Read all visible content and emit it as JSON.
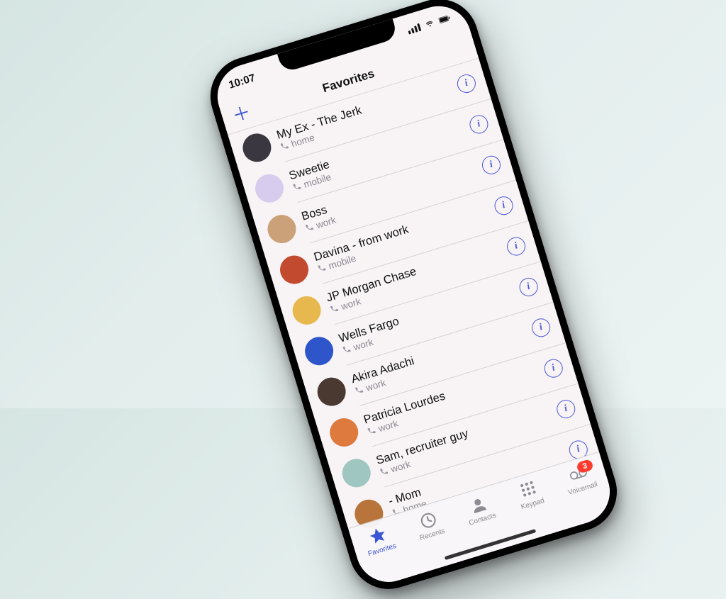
{
  "status": {
    "time": "10:07"
  },
  "navbar": {
    "title": "Favorites"
  },
  "favorites": [
    {
      "name": "My Ex - The Jerk",
      "label": "home",
      "avatar_class": "av-dark"
    },
    {
      "name": "Sweetie",
      "label": "mobile",
      "avatar_class": "av-lilac"
    },
    {
      "name": "Boss",
      "label": "work",
      "avatar_class": "av-tan"
    },
    {
      "name": "Davina - from work",
      "label": "mobile",
      "avatar_class": "av-red"
    },
    {
      "name": "JP Morgan Chase",
      "label": "work",
      "avatar_class": "av-gold"
    },
    {
      "name": "Wells Fargo",
      "label": "work",
      "avatar_class": "av-blue"
    },
    {
      "name": "Akira Adachi",
      "label": "work",
      "avatar_class": "av-brown"
    },
    {
      "name": "Patricia Lourdes",
      "label": "work",
      "avatar_class": "av-orange"
    },
    {
      "name": "Sam, recruiter guy",
      "label": "work",
      "avatar_class": "av-teal"
    },
    {
      "name": "- Mom",
      "label": "home",
      "avatar_class": "av-ginger"
    }
  ],
  "tabs": {
    "favorites": "Favorites",
    "recents": "Recents",
    "contacts": "Contacts",
    "keypad": "Keypad",
    "voicemail": "Voicemail",
    "voicemail_badge": "3"
  }
}
